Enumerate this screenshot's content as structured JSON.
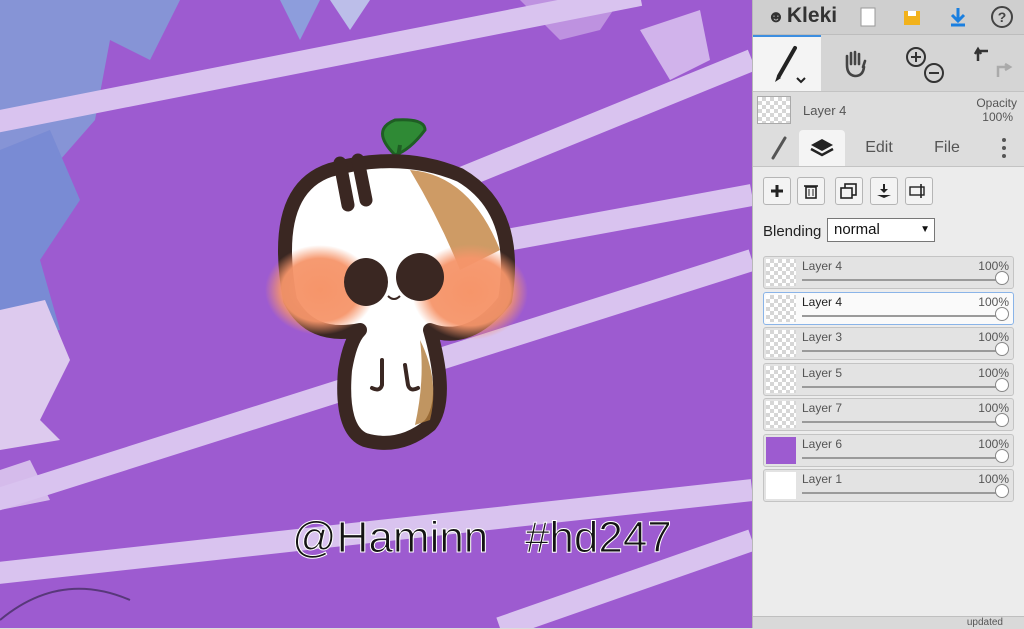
{
  "app": {
    "logo_text": "Kleki"
  },
  "topbar": {
    "buttons": [
      "new-file-icon",
      "save-icon",
      "download-icon",
      "help-icon"
    ],
    "help_label": "?"
  },
  "tools": {
    "items": [
      "brush-tool",
      "hand-tool",
      "zoom-tool",
      "undo-redo"
    ]
  },
  "current_layer": {
    "name": "Layer 4",
    "opacity_label": "Opacity",
    "opacity_value": "100%"
  },
  "tabs": {
    "edit": "Edit",
    "file": "File"
  },
  "layer_panel": {
    "blending_label": "Blending",
    "blending_value": "normal",
    "layers": [
      {
        "name": "Layer 4",
        "opacity": "100%",
        "active": false,
        "thumb": "transparent"
      },
      {
        "name": "Layer 4",
        "opacity": "100%",
        "active": true,
        "thumb": "transparent"
      },
      {
        "name": "Layer 3",
        "opacity": "100%",
        "active": false,
        "thumb": "transparent"
      },
      {
        "name": "Layer 5",
        "opacity": "100%",
        "active": false,
        "thumb": "transparent"
      },
      {
        "name": "Layer 7",
        "opacity": "100%",
        "active": false,
        "thumb": "transparent"
      },
      {
        "name": "Layer 6",
        "opacity": "100%",
        "active": false,
        "thumb": "purple"
      },
      {
        "name": "Layer 1",
        "opacity": "100%",
        "active": false,
        "thumb": "white"
      }
    ]
  },
  "bottom": {
    "status_text": "updated"
  },
  "canvas": {
    "watermark_text": "@Haminn   #hd247",
    "colors": {
      "background": "#9d5bd0",
      "stripes": "#d9c3ef",
      "outline": "#3a2722",
      "blush": "#f6956a",
      "leaf": "#2f8a35"
    }
  }
}
